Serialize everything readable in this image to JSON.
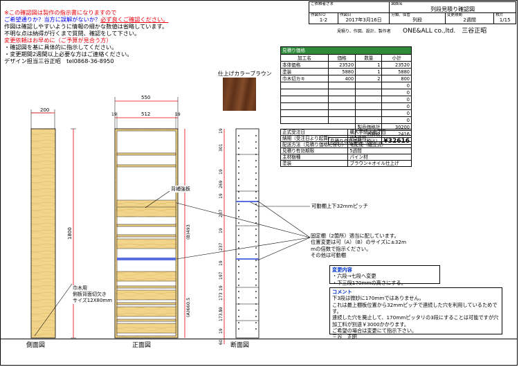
{
  "notes": {
    "l1": "※この確認図は製作の指示書になりますので",
    "l2a": "ご希望通りか？当方に誤解がないか？",
    "l2b": "必ず良くご確認ください。",
    "l3": "作図は確認しやすいように情報の細かな数値は省略しています。",
    "l4": "不明な点は納得が行くまで質問、確認をして下さい。",
    "l5": "変更依頼はお早めに（ご予算が見合う方）",
    "l6": "・確認図を基に具体的に指示してください。",
    "l7": "・変更期間2週間以上必要な方はご連絡ください。",
    "l8": "デザイン担当三谷正昭　tel0868-36-8950"
  },
  "title_block": {
    "client_label": "ご依頼者さま",
    "drawing_name_label": "図面名",
    "drawing_name": "列段見積り確認図",
    "drawing_no_label": "作図ＮＯ",
    "drawing_no": "1-2",
    "date_label": "作図日",
    "date": "2017年3月16日",
    "class_label": "分類、保管",
    "class": "列段",
    "period_label": "変更期間",
    "period": "2週間",
    "pages_label": "枚片",
    "pages": "1/15",
    "roles": "見積り、作図、設計、製作者",
    "company": "ONE&ALL co.,ltd.　三谷正昭"
  },
  "estimate": {
    "header": "見積り価格",
    "col_item": "加工名",
    "col_price": "価格",
    "col_qty": "数量",
    "col_subtotal": "小計",
    "rows": [
      {
        "name": "本体価格",
        "price": "23520",
        "qty": "1",
        "sub": "23520"
      },
      {
        "name": "塗装",
        "price": "5880",
        "qty": "1",
        "sub": "5880"
      },
      {
        "name": "巾木切カキ",
        "price": "400",
        "qty": "2",
        "sub": "800"
      },
      {
        "name": "",
        "price": "",
        "qty": "",
        "sub": "0"
      },
      {
        "name": "",
        "price": "",
        "qty": "",
        "sub": "0"
      },
      {
        "name": "",
        "price": "",
        "qty": "",
        "sub": "0"
      },
      {
        "name": "",
        "price": "",
        "qty": "",
        "sub": "0"
      },
      {
        "name": "",
        "price": "",
        "qty": "",
        "sub": "0"
      },
      {
        "name": "",
        "price": "",
        "qty": "",
        "sub": "0"
      }
    ],
    "product_total_label": "製品価格計",
    "product_total": "30200",
    "tax_label": "消費税",
    "tax": "2416",
    "grand_label": "見積り合計価格（税込）",
    "grand_total": "¥32616"
  },
  "info_rows": [
    {
      "k": "正式受注日",
      "v": "購入手続き完了日"
    },
    {
      "k": "納期（受注日より起算）",
      "v": "約5週間"
    },
    {
      "k": "配送方法（見積り価格に含む）",
      "v": "宅配便（組立式）"
    },
    {
      "k": "見積り有効期限",
      "v": "5週間"
    },
    {
      "k": "主材樹種",
      "v": "パイン材"
    },
    {
      "k": "塗装",
      "v": "ブラウン+オイル仕上げ"
    }
  ],
  "swatch": {
    "label": "仕上げカラーブラウン",
    "color": "#6b3a1f"
  },
  "callouts": {
    "reinforce": "背補強板",
    "pitch": "可動棚上下32mmピッチ",
    "fixed": "固定棚（2箇所）適当に配しています。\n位置変更は可（A）（B）のサイズに±32m\nmの倍数で指示ください。\nその他は可動棚",
    "skirting": "巾木用\n側板背面切欠き\nサイズ12X80mm"
  },
  "changes": {
    "title": "変更内容",
    "l1": "・六段→七段へ変更",
    "l2": "・下三段170mmの高さにする。"
  },
  "comment": {
    "title": "コメント",
    "body": "下3段は微妙に170mmではありません。\nこれは最上棚板位置から32mmピッチで連続した穴を利用しているためです。\n連続した穴を廃止して、170mmピッタリの3段にすることは可能ですが穴加工料が別途￥3000かかります。\nご希望の場合は変更にて指示下さい。\n三谷　正昭"
  },
  "captions": {
    "side": "側面図",
    "front": "正面図",
    "section": "断面図"
  },
  "dims": {
    "side_depth": "200",
    "height": "1800",
    "front_width": "550",
    "inner_width": "512",
    "side_thk": "19",
    "section_depth": "190",
    "b_dim": "(B)493",
    "a_dim": "(A)660.5",
    "sec_dims": [
      "19",
      "301",
      "19",
      "269",
      "19",
      "237",
      "19",
      "237",
      "19",
      "197",
      "19",
      "173",
      "19",
      "173.5",
      "19",
      "60"
    ]
  },
  "colors": {
    "wood": "#f2d58a",
    "wood_line": "#8a6a1a",
    "red": "#e8000b",
    "blue_shelf": "#5a6ee0",
    "green_header": "#2e8b3a"
  }
}
